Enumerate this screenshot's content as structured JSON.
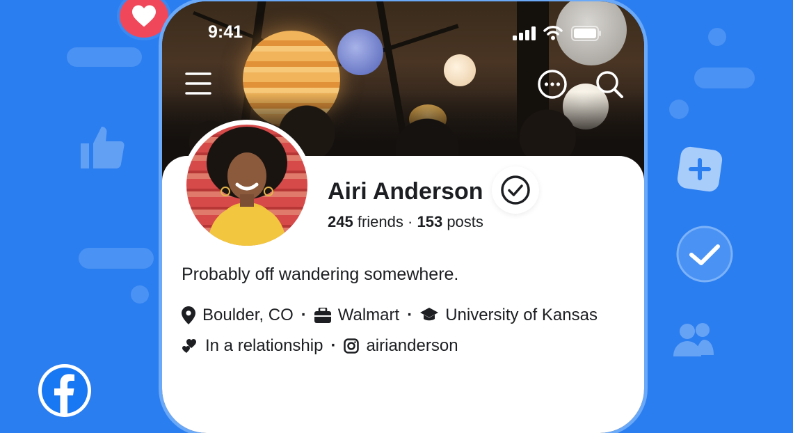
{
  "status_bar": {
    "time": "9:41"
  },
  "profile": {
    "name": "Airi Anderson",
    "friends_count": "245",
    "friends_label": "friends",
    "separator": "·",
    "posts_count": "153",
    "posts_label": "posts",
    "bio": "Probably off wandering somewhere.",
    "location": "Boulder, CO",
    "work": "Walmart",
    "education": "University of Kansas",
    "relationship": "In a relationship",
    "instagram": "airianderson"
  },
  "icons": {
    "top_left_badge": "heart-icon",
    "bottom_left_badge": "facebook-logo-icon",
    "left_decor": "thumbs-up-icon",
    "right_decor_1": "plus-icon",
    "right_decor_2": "check-icon",
    "right_decor_3": "people-icon",
    "nav_left": "hamburger-menu-icon",
    "nav_right_1": "more-options-icon",
    "nav_right_2": "search-icon",
    "verified": "verified-check-icon",
    "status": [
      "signal-icon",
      "wifi-icon",
      "battery-icon"
    ],
    "info": [
      "location-pin-icon",
      "briefcase-icon",
      "graduation-cap-icon",
      "hearts-icon",
      "instagram-icon"
    ]
  },
  "colors": {
    "background": "#2b7ef0",
    "heart_badge": "#f0485a",
    "facebook_blue": "#1877f2",
    "text": "#1c1e21"
  }
}
